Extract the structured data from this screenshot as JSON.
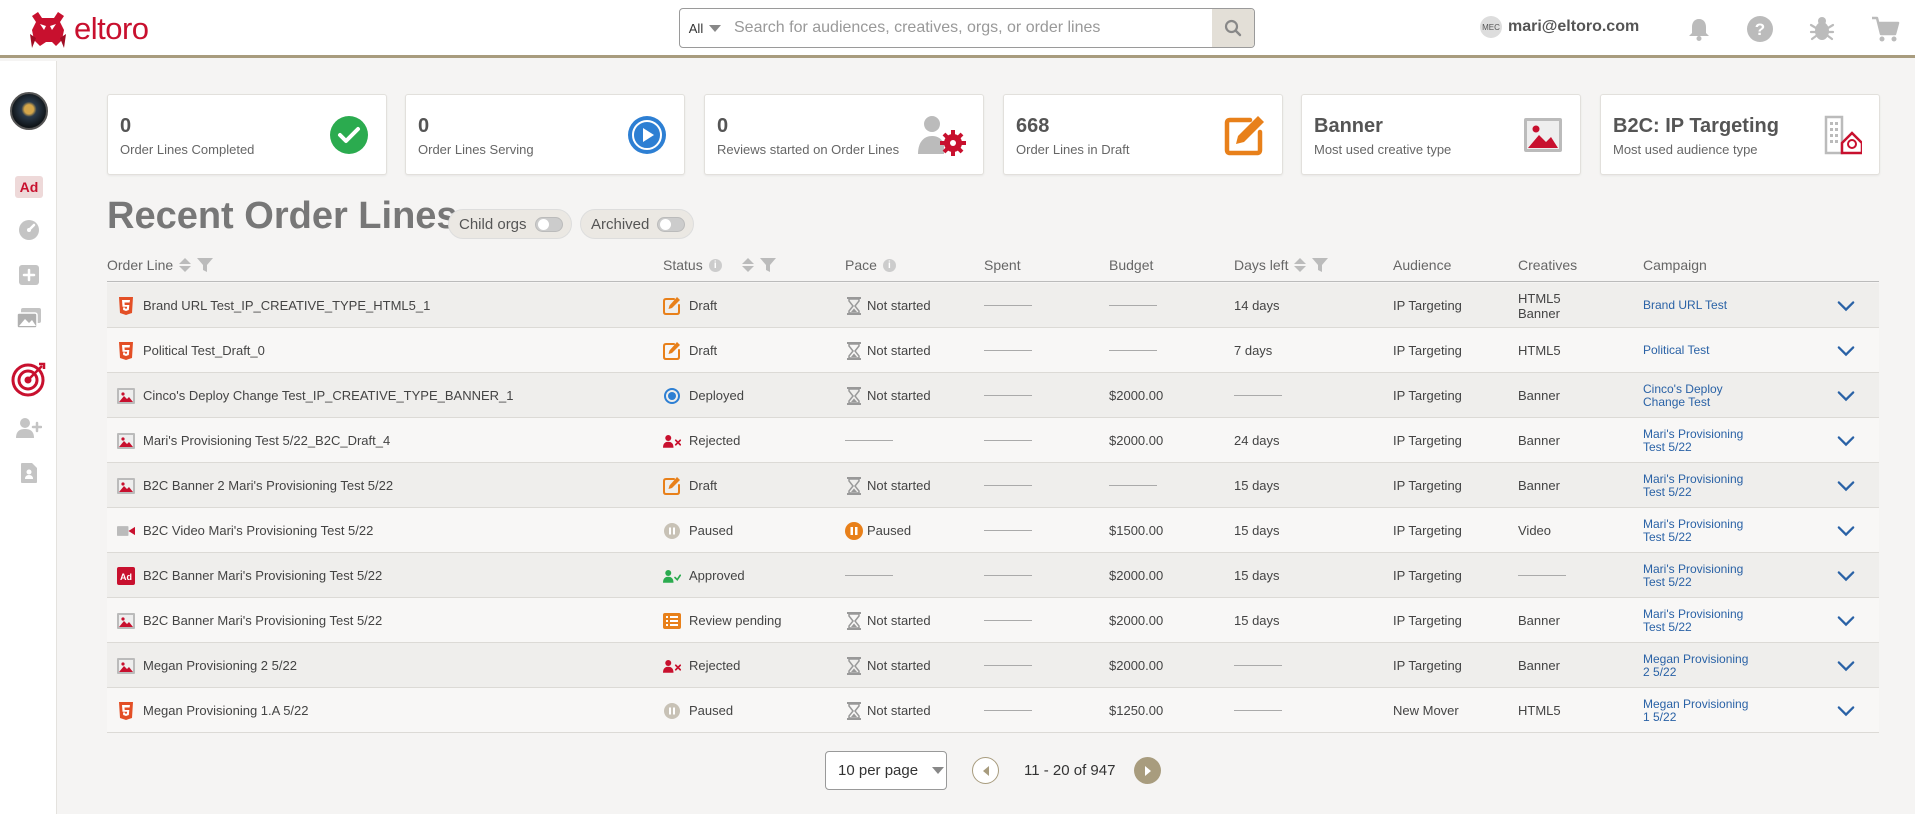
{
  "app": {
    "logo_text": "eltoro"
  },
  "search": {
    "scope": "All",
    "placeholder": "Search for audiences, creatives, orgs, or order lines"
  },
  "user": {
    "initials": "MEC",
    "email": "mari@eltoro.com"
  },
  "icons": {
    "top": [
      "bell-icon",
      "help-icon",
      "bug-icon",
      "cart-icon"
    ],
    "sidebar": [
      "org-avatar",
      "ad-icon",
      "dashboard-icon",
      "add-icon",
      "creatives-icon",
      "targeting-icon",
      "add-user-icon",
      "document-icon"
    ]
  },
  "stats": [
    {
      "value": "0",
      "label": "Order Lines Completed",
      "icon": "check-circle-icon",
      "color": "#2bab4f"
    },
    {
      "value": "0",
      "label": "Order Lines Serving",
      "icon": "play-circle-icon",
      "color": "#2d7fd3"
    },
    {
      "value": "0",
      "label": "Reviews started on Order Lines",
      "icon": "user-gear-icon",
      "color": "#c8102e"
    },
    {
      "value": "668",
      "label": "Order Lines in Draft",
      "icon": "edit-icon",
      "color": "#e8801a"
    },
    {
      "value": "Banner",
      "label": "Most used creative type",
      "icon": "image-icon",
      "color": "#c8102e"
    },
    {
      "value": "B2C: IP Targeting",
      "label": "Most used audience type",
      "icon": "building-icon",
      "color": "#c8102e"
    }
  ],
  "heading": "Recent Order Lines",
  "toggles": {
    "child_orgs": "Child orgs",
    "archived": "Archived"
  },
  "columns": {
    "order_line": "Order Line",
    "status": "Status",
    "pace": "Pace",
    "spent": "Spent",
    "budget": "Budget",
    "days_left": "Days left",
    "audience": "Audience",
    "creatives": "Creatives",
    "campaign": "Campaign"
  },
  "rows": [
    {
      "type_icon": "html5-icon",
      "name": "Brand URL Test_IP_CREATIVE_TYPE_HTML5_1",
      "status": "Draft",
      "status_icon": "draft-icon",
      "pace": "Not started",
      "spent": "",
      "budget": "",
      "days_left": "14 days",
      "audience": "IP Targeting",
      "creatives": [
        "HTML5",
        "Banner"
      ],
      "campaign": [
        "Brand URL Test"
      ]
    },
    {
      "type_icon": "html5-icon",
      "name": "Political Test_Draft_0",
      "status": "Draft",
      "status_icon": "draft-icon",
      "pace": "Not started",
      "spent": "",
      "budget": "",
      "days_left": "7 days",
      "audience": "IP Targeting",
      "creatives": [
        "HTML5"
      ],
      "campaign": [
        "Political Test"
      ]
    },
    {
      "type_icon": "image-icon",
      "name": "Cinco's Deploy Change Test_IP_CREATIVE_TYPE_BANNER_1",
      "status": "Deployed",
      "status_icon": "deployed-icon",
      "pace": "Not started",
      "spent": "",
      "budget": "$2000.00",
      "days_left": "",
      "audience": "IP Targeting",
      "creatives": [
        "Banner"
      ],
      "campaign": [
        "Cinco's Deploy",
        "Change Test"
      ]
    },
    {
      "type_icon": "image-icon",
      "name": "Mari's Provisioning Test 5/22_B2C_Draft_4",
      "status": "Rejected",
      "status_icon": "rejected-icon",
      "pace": "",
      "spent": "",
      "budget": "$2000.00",
      "days_left": "24 days",
      "audience": "IP Targeting",
      "creatives": [
        "Banner"
      ],
      "campaign": [
        "Mari's Provisioning",
        "Test 5/22"
      ]
    },
    {
      "type_icon": "image-icon",
      "name": "B2C Banner 2 Mari's Provisioning Test 5/22",
      "status": "Draft",
      "status_icon": "draft-icon",
      "pace": "Not started",
      "spent": "",
      "budget": "",
      "days_left": "15 days",
      "audience": "IP Targeting",
      "creatives": [
        "Banner"
      ],
      "campaign": [
        "Mari's Provisioning",
        "Test 5/22"
      ]
    },
    {
      "type_icon": "video-icon",
      "name": "B2C Video Mari's Provisioning Test 5/22",
      "status": "Paused",
      "status_icon": "paused-icon",
      "pace": "Paused",
      "pace_icon": "pace-paused-icon",
      "spent": "",
      "budget": "$1500.00",
      "days_left": "15 days",
      "audience": "IP Targeting",
      "creatives": [
        "Video"
      ],
      "campaign": [
        "Mari's Provisioning",
        "Test 5/22"
      ]
    },
    {
      "type_icon": "ad-icon",
      "name": "B2C Banner Mari's Provisioning Test 5/22",
      "status": "Approved",
      "status_icon": "approved-icon",
      "pace": "",
      "spent": "",
      "budget": "$2000.00",
      "days_left": "15 days",
      "audience": "IP Targeting",
      "creatives": [],
      "campaign": [
        "Mari's Provisioning",
        "Test 5/22"
      ]
    },
    {
      "type_icon": "image-icon",
      "name": "B2C Banner Mari's Provisioning Test 5/22",
      "status": "Review pending",
      "status_icon": "review-pending-icon",
      "pace": "Not started",
      "spent": "",
      "budget": "$2000.00",
      "days_left": "15 days",
      "audience": "IP Targeting",
      "creatives": [
        "Banner"
      ],
      "campaign": [
        "Mari's Provisioning",
        "Test 5/22"
      ]
    },
    {
      "type_icon": "image-icon",
      "name": "Megan Provisioning 2 5/22",
      "status": "Rejected",
      "status_icon": "rejected-icon",
      "pace": "Not started",
      "spent": "",
      "budget": "$2000.00",
      "days_left": "",
      "audience": "IP Targeting",
      "creatives": [
        "Banner"
      ],
      "campaign": [
        "Megan Provisioning",
        "2 5/22"
      ]
    },
    {
      "type_icon": "html5-icon",
      "name": "Megan Provisioning 1.A 5/22",
      "status": "Paused",
      "status_icon": "paused-icon",
      "pace": "Not started",
      "spent": "",
      "budget": "$1250.00",
      "days_left": "",
      "audience": "New Mover",
      "creatives": [
        "HTML5"
      ],
      "campaign": [
        "Megan Provisioning",
        "1 5/22"
      ]
    }
  ],
  "pagination": {
    "per_page": "10 per page",
    "range": "11 - 20 of 947"
  }
}
